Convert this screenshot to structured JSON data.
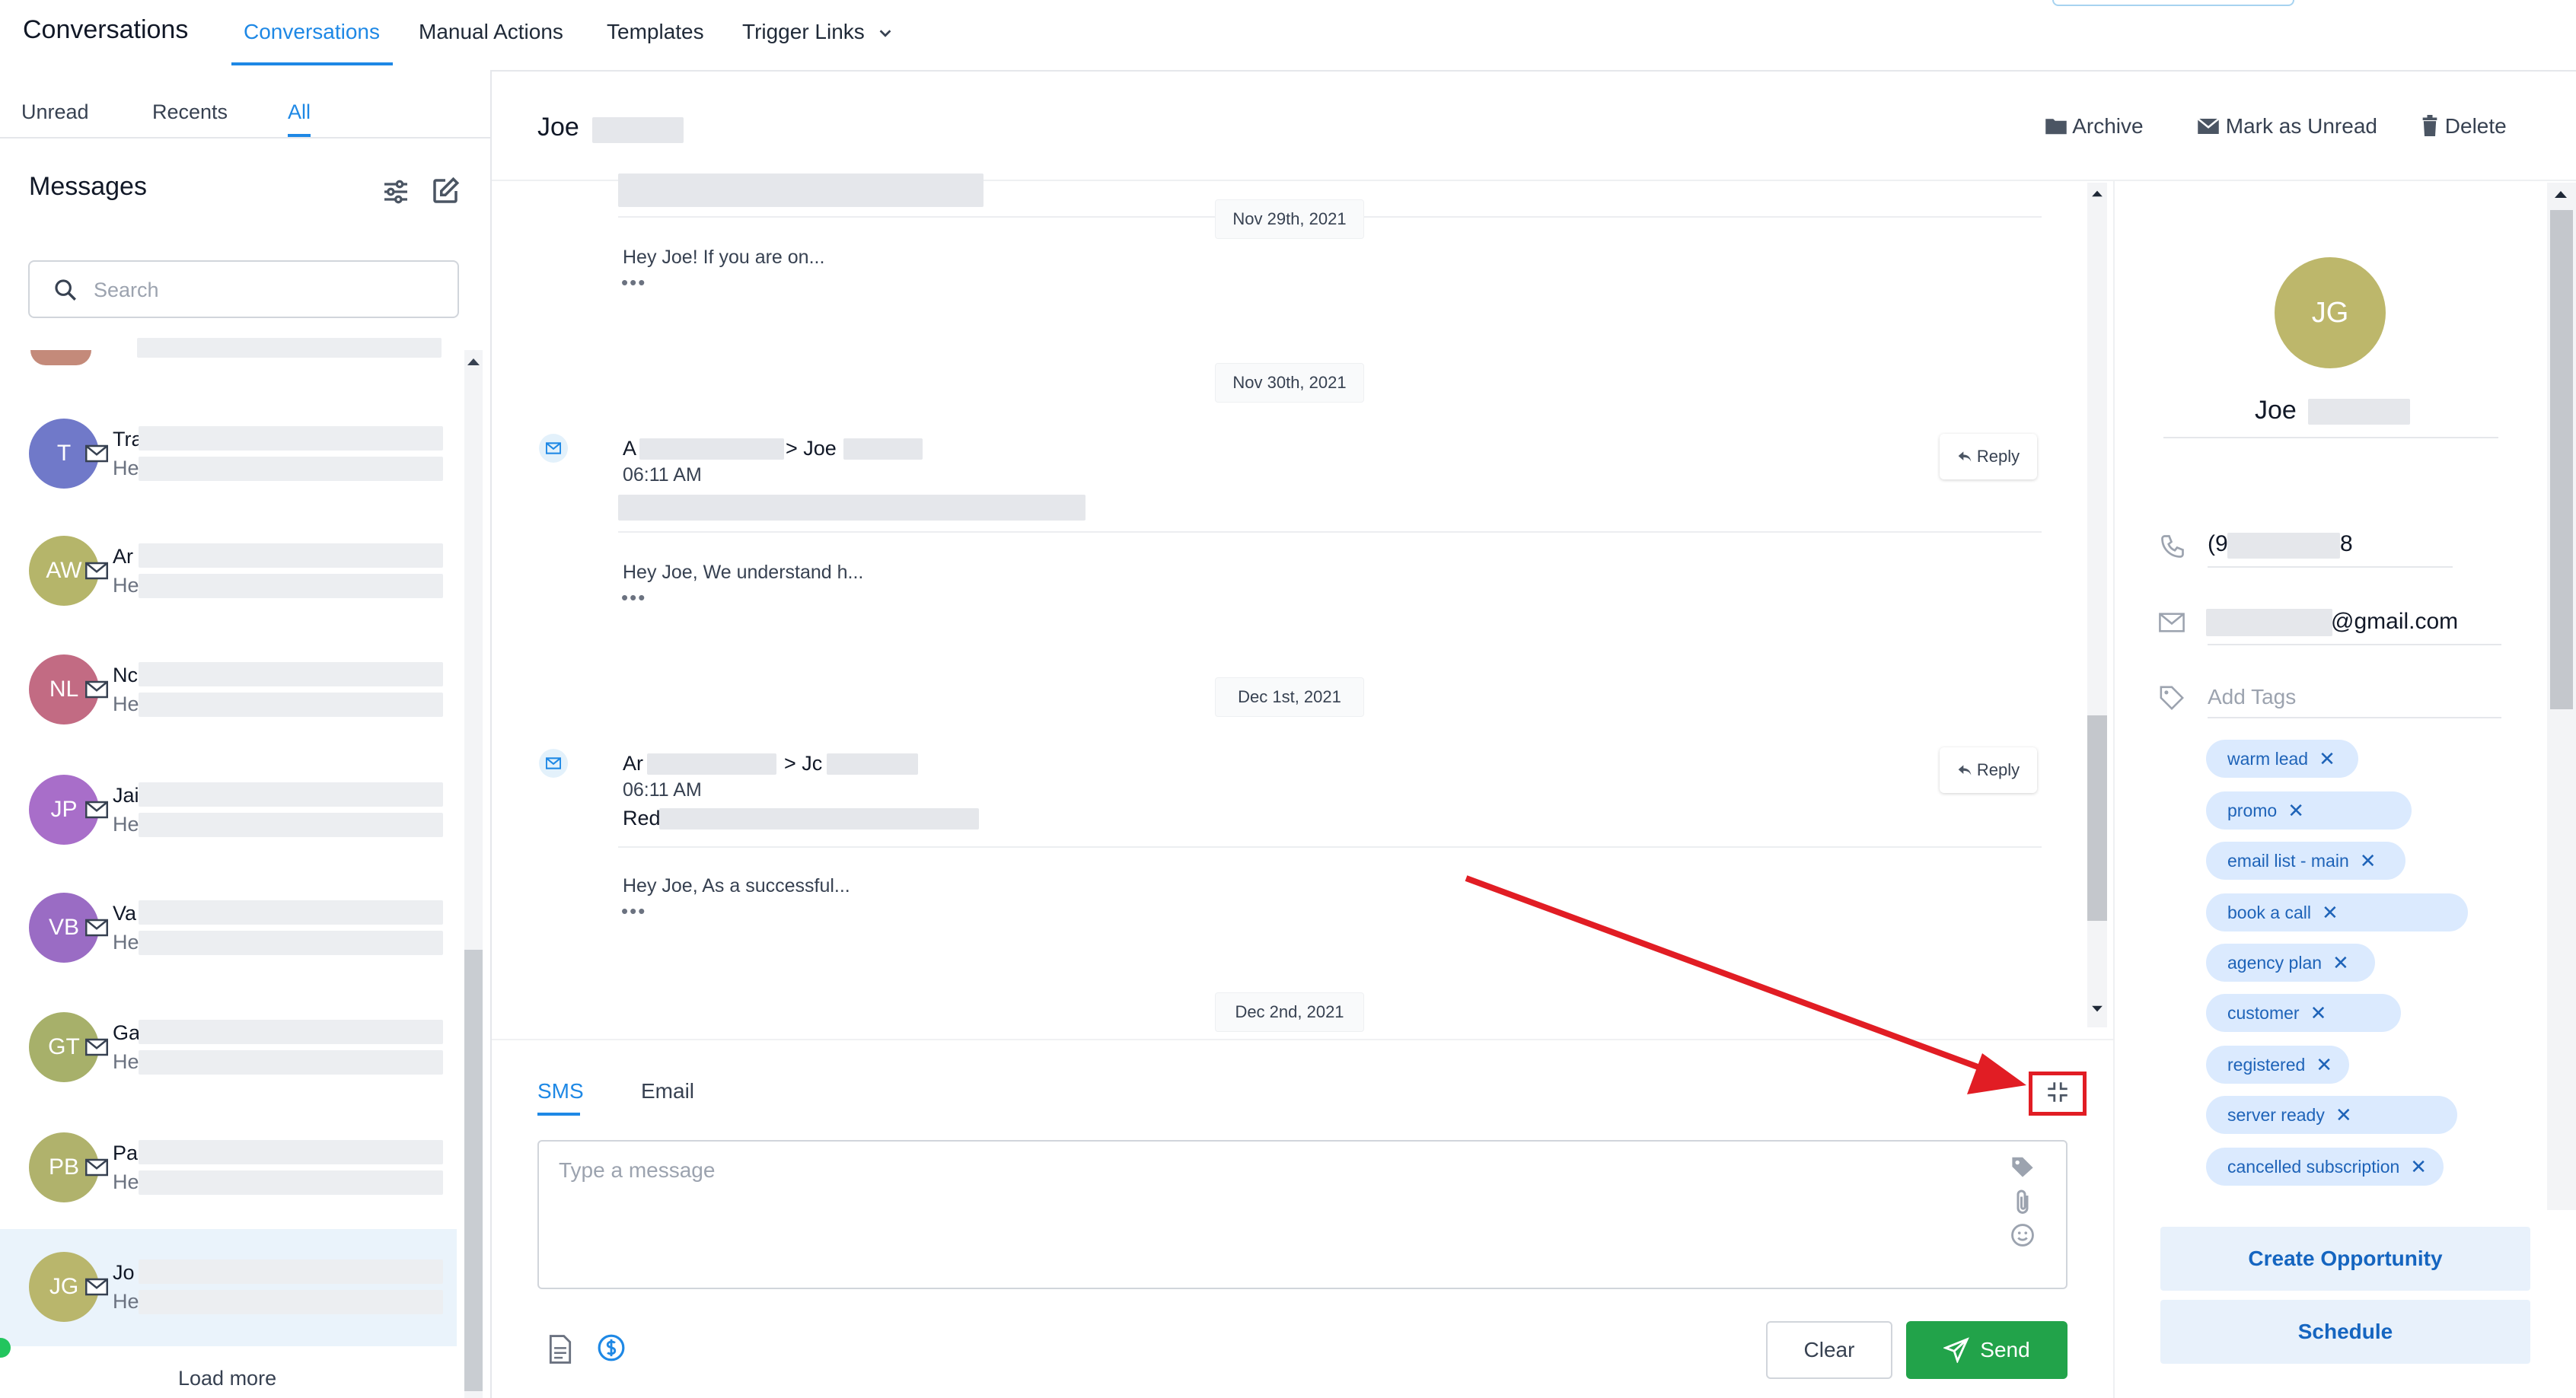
{
  "app": {
    "title": "Conversations"
  },
  "nav": {
    "tabs": [
      {
        "label": "Conversations"
      },
      {
        "label": "Manual Actions"
      },
      {
        "label": "Templates"
      },
      {
        "label": "Trigger Links"
      }
    ]
  },
  "sidebar": {
    "tabs": [
      {
        "label": "Unread"
      },
      {
        "label": "Recents"
      },
      {
        "label": "All"
      }
    ],
    "messages_title": "Messages",
    "search_placeholder": "Search",
    "conversations": [
      {
        "initials": "T",
        "name": "Tra",
        "preview": "He",
        "color": "#7079c9"
      },
      {
        "initials": "AW",
        "name": "Ar",
        "preview": "He",
        "color": "#b5b56a"
      },
      {
        "initials": "NL",
        "name": "Nc",
        "preview": "He",
        "color": "#c26b83"
      },
      {
        "initials": "JP",
        "name": "Jai",
        "preview": "He",
        "color": "#a86ec9"
      },
      {
        "initials": "VB",
        "name": "Va",
        "preview": "He",
        "color": "#9a6cc4"
      },
      {
        "initials": "GT",
        "name": "Ga",
        "preview": "He",
        "color": "#a7b06a"
      },
      {
        "initials": "PB",
        "name": "Pa",
        "preview": "He",
        "color": "#b0b26c"
      },
      {
        "initials": "JG",
        "name": "Jo",
        "preview": "He",
        "color": "#b9b66c"
      }
    ],
    "load_more": "Load more"
  },
  "thread": {
    "contact_name": "Joe",
    "actions": {
      "archive": "Archive",
      "mark_unread": "Mark as Unread",
      "delete": "Delete"
    },
    "dates": [
      "Nov 29th, 2021",
      "Nov 30th, 2021",
      "Dec 1st, 2021",
      "Dec 2nd, 2021"
    ],
    "snippets": [
      "Hey Joe! If you are on...",
      "Hey Joe, We understand h...",
      "Hey Joe, As a successful..."
    ],
    "dots": "•••",
    "messages": [
      {
        "from": "A",
        "to_prefix": "> Joe",
        "time": "06:11 AM"
      },
      {
        "from": "Ar",
        "to_prefix": "> Jc",
        "time": "06:11 AM",
        "subject": "Red"
      }
    ],
    "reply_label": "Reply"
  },
  "composer": {
    "tabs": [
      {
        "label": "SMS"
      },
      {
        "label": "Email"
      }
    ],
    "placeholder": "Type a message",
    "clear_label": "Clear",
    "send_label": "Send"
  },
  "contact": {
    "initials": "JG",
    "name": "Joe",
    "phone_prefix": "(9",
    "phone_suffix": "8",
    "email_suffix": "@gmail.com",
    "add_tags_label": "Add Tags",
    "tags": [
      {
        "label": "warm lead"
      },
      {
        "label": "promo"
      },
      {
        "label": "email list - main"
      },
      {
        "label": "book a call"
      },
      {
        "label": "agency plan"
      },
      {
        "label": "customer"
      },
      {
        "label": "registered"
      },
      {
        "label": "server ready"
      },
      {
        "label": "cancelled subscription"
      }
    ],
    "create_opportunity": "Create Opportunity",
    "schedule": "Schedule"
  },
  "colors": {
    "accent": "#1e88e5",
    "send": "#22a34a",
    "highlight": "#e11d24",
    "arrow": "#e11d24"
  },
  "icons": [
    "filter-icon",
    "compose-icon",
    "search-icon",
    "mail-icon",
    "folder-icon",
    "envelope-icon",
    "trash-icon",
    "reply-icon",
    "collapse-icon",
    "tag-icon",
    "paperclip-icon",
    "emoji-icon",
    "document-icon",
    "dollar-icon",
    "send-icon",
    "phone-icon",
    "chevron-down-icon"
  ]
}
